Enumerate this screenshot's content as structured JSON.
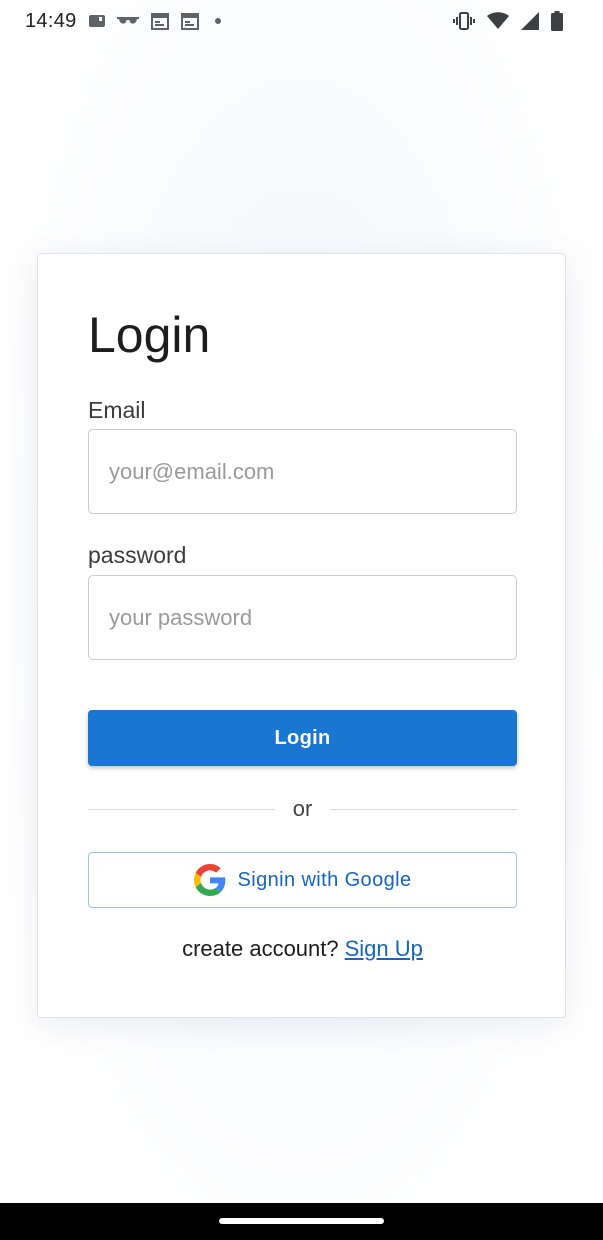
{
  "status_bar": {
    "time": "14:49",
    "left_icons": [
      "sim-icon",
      "glasses-icon",
      "calendar-icon",
      "calendar-icon",
      "dot-icon"
    ],
    "right_icons": [
      "vibrate-icon",
      "wifi-icon",
      "signal-icon",
      "battery-icon"
    ]
  },
  "login_form": {
    "title": "Login",
    "email": {
      "label": "Email",
      "placeholder": "your@email.com",
      "value": ""
    },
    "password": {
      "label": "password",
      "placeholder": "your password",
      "value": ""
    },
    "login_button": "Login",
    "divider_text": "or",
    "google_button": "Signin with Google",
    "signup_prompt": "create account?",
    "signup_link": "Sign Up"
  },
  "colors": {
    "primary": "#1976d2",
    "link": "#1565c0",
    "google_border": "#9cc3e8"
  }
}
